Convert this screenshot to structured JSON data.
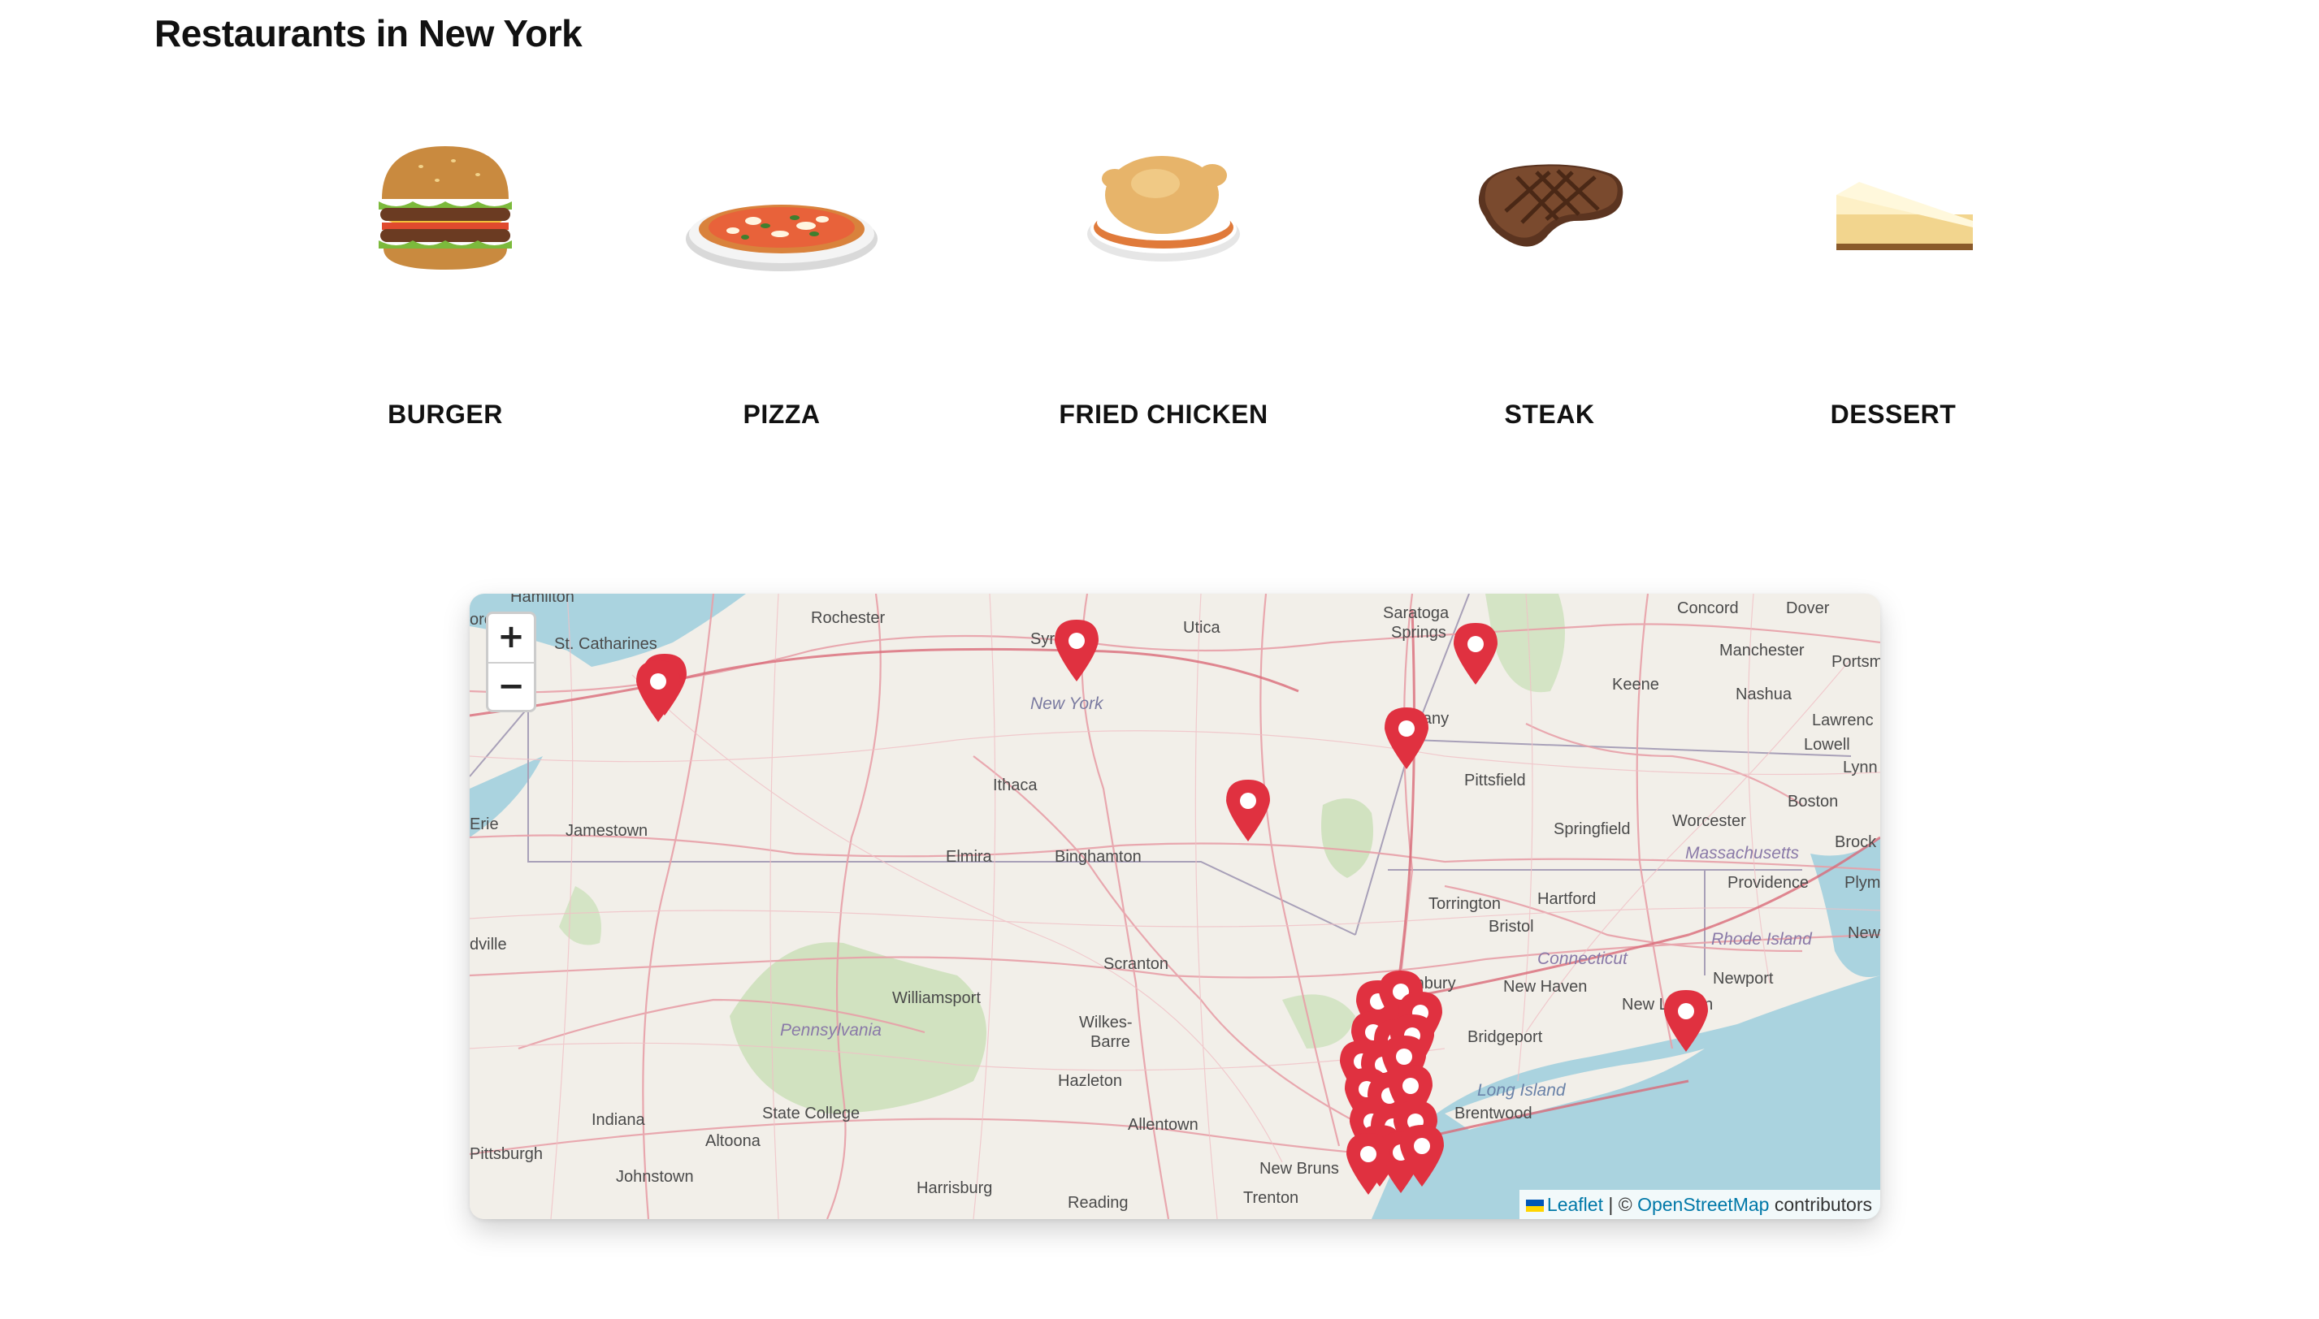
{
  "page": {
    "title": "Restaurants in New York"
  },
  "categories": [
    {
      "label": "BURGER",
      "icon": "burger-icon"
    },
    {
      "label": "PIZZA",
      "icon": "pizza-icon"
    },
    {
      "label": "FRIED CHICKEN",
      "icon": "fried-chicken-icon"
    },
    {
      "label": "STEAK",
      "icon": "steak-icon"
    },
    {
      "label": "DESSERT",
      "icon": "cheesecake-icon"
    }
  ],
  "map": {
    "zoom": {
      "in_label": "+",
      "out_label": "−"
    },
    "labels": {
      "cities": [
        "Hamilton",
        "Rochester",
        "Syracuse",
        "Utica",
        "Saratoga",
        "Springs",
        "Concord",
        "Dover",
        "Manchester",
        "Portsm",
        "Keene",
        "Nashua",
        "Lowell",
        "Lawrenc",
        "Lynn",
        "St. Catharines",
        "Ithaca",
        "Albany",
        "Pittsfield",
        "Boston",
        "Erie",
        "Jamestown",
        "Elmira",
        "Binghamton",
        "Springfield",
        "Worcester",
        "Brock",
        "Providence",
        "Plym",
        "Torrington",
        "Hartford",
        "Bristol",
        "Newp",
        "Danbury",
        "New Haven",
        "Newport",
        "Scranton",
        "Williamsport",
        "Wilkes-",
        "Barre",
        "Bridgeport",
        "New London",
        "Hazleton",
        "State College",
        "Brentwood",
        "Indiana",
        "Altoona",
        "Allentown",
        "New Bruns",
        "Pittsburgh",
        "Johnstown",
        "Harrisburg",
        "Reading",
        "Trenton",
        "dville",
        "ore"
      ],
      "regions": [
        "New York",
        "Massachusetts",
        "Pennsylvania",
        "Connecticut",
        "Rhode Island",
        "Long Island"
      ]
    },
    "marker_color": "#e03140",
    "attribution": {
      "leaflet": "Leaflet",
      "separator": " | © ",
      "osm": "OpenStreetMap",
      "suffix": " contributors"
    }
  }
}
